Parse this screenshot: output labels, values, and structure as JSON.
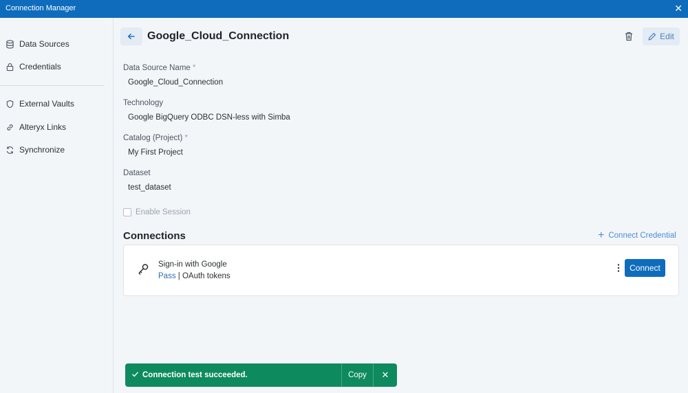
{
  "window": {
    "title": "Connection Manager",
    "close_glyph": "✕"
  },
  "sidebar": {
    "items": [
      {
        "label": "Data Sources",
        "icon": "database-icon"
      },
      {
        "label": "Credentials",
        "icon": "lock-icon"
      },
      {
        "label": "External Vaults",
        "icon": "shield-icon"
      },
      {
        "label": "Alteryx Links",
        "icon": "link-icon"
      },
      {
        "label": "Synchronize",
        "icon": "sync-icon"
      }
    ]
  },
  "header": {
    "title": "Google_Cloud_Connection",
    "edit_label": "Edit"
  },
  "fields": {
    "data_source_name": {
      "label": "Data Source Name",
      "required_mark": "*",
      "value": "Google_Cloud_Connection"
    },
    "technology": {
      "label": "Technology",
      "value": "Google BigQuery ODBC DSN-less with Simba"
    },
    "catalog": {
      "label": "Catalog (Project)",
      "required_mark": "*",
      "value": "My First Project"
    },
    "dataset": {
      "label": "Dataset",
      "value": "test_dataset"
    },
    "enable_session": {
      "label": "Enable Session",
      "checked": false
    }
  },
  "connections": {
    "title": "Connections",
    "add_label": "Connect Credential",
    "items": [
      {
        "name": "Sign-in with Google",
        "status": "Pass",
        "separator": " | ",
        "type": "OAuth tokens",
        "action": "Connect"
      }
    ]
  },
  "toast": {
    "message": "Connection test succeeded.",
    "copy_label": "Copy",
    "close_glyph": "✕"
  },
  "colors": {
    "accent": "#0f6cbd",
    "success": "#0e8a5f",
    "link": "#4a8cd8"
  }
}
